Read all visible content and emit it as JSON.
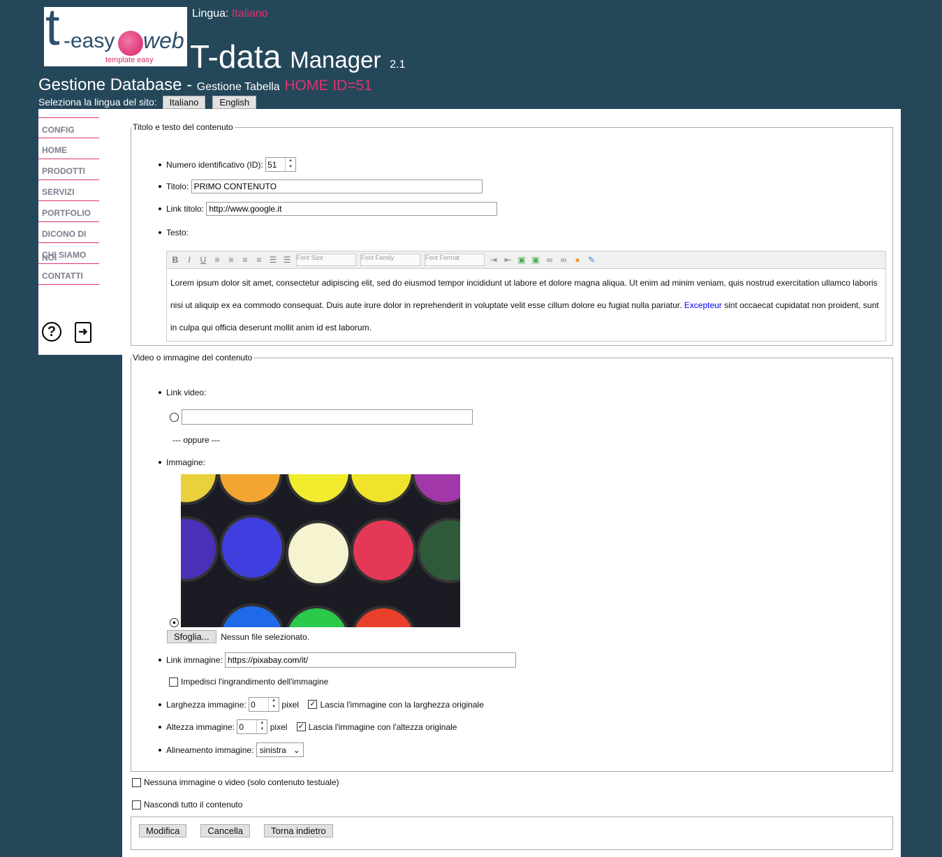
{
  "header": {
    "logo_text": "t-easy web template easy",
    "lingua_label": "Lingua:",
    "lingua_value": "Italiano",
    "app_title": "T-data",
    "app_title2": "Manager",
    "version": "2.1",
    "section": "Gestione Database -",
    "subsection": "Gestione Tabella",
    "record": "HOME ID=51",
    "lang_label": "Seleziona la lingua del sito:",
    "lang_buttons": [
      "Italiano",
      "English"
    ]
  },
  "sidebar": {
    "items": [
      "CONFIG",
      "HOME",
      "PRODOTTI",
      "SERVIZI",
      "PORTFOLIO",
      "DICONO DI NOI",
      "CHI SIAMO",
      "CONTATTI"
    ],
    "icons": [
      "help-icon",
      "logout-icon"
    ]
  },
  "form": {
    "fieldset1": "Titolo e testo del contenuto",
    "id_label": "Numero identificativo (ID):",
    "id_value": "51",
    "title_label": "Titolo:",
    "title_value": "PRIMO CONTENUTO",
    "link_label": "Link titolo:",
    "link_value": "http://www.google.it",
    "text_label": "Testo:",
    "toolbar": {
      "font_size": "Font Size",
      "font_family": "Font Family",
      "font_format": "Font Format"
    },
    "text_before": "Lorem ipsum dolor sit amet, consectetur adipiscing elit, sed do eiusmod tempor incididunt ut labore et dolore magna aliqua. Ut enim ad minim veniam, quis nostrud exercitation ullamco laboris nisi ut aliquip ex ea commodo consequat. Duis aute irure dolor in reprehenderit in voluptate velit esse cillum dolore eu fugiat nulla pariatur.",
    "text_link": "Excepteur",
    "text_after": " sint occaecat cupidatat non proident, sunt in culpa qui officia deserunt mollit anim id est laborum.",
    "fieldset2": "Video o immagine del contenuto",
    "video_label": "Link video:",
    "video_value": "",
    "oppure": "--- oppure ---",
    "image_label": "Immagine:",
    "browse": "Sfoglia...",
    "no_file": "Nessun file selezionato.",
    "img_link_label": "Link immagine:",
    "img_link_value": "https://pixabay.com/it/",
    "no_zoom": "Impedisci l'ingrandimento dell'immagine",
    "width_label": "Larghezza immagine:",
    "width_value": "0",
    "pixel": "pixel",
    "keep_width": "Lascia l'immagine con la larghezza originale",
    "height_label": "Altezza immagine:",
    "height_value": "0",
    "keep_height": "Lascia l'immagine con l'altezza originale",
    "align_label": "Alineamento immagine:",
    "align_value": "sinistra",
    "no_media": "Nessuna immagine o video (solo contenuto testuale)",
    "hide_all": "Nascondi tutto il contenuto",
    "buttons": {
      "modify": "Modifica",
      "cancel": "Cancella",
      "back": "Torna indietro"
    }
  }
}
